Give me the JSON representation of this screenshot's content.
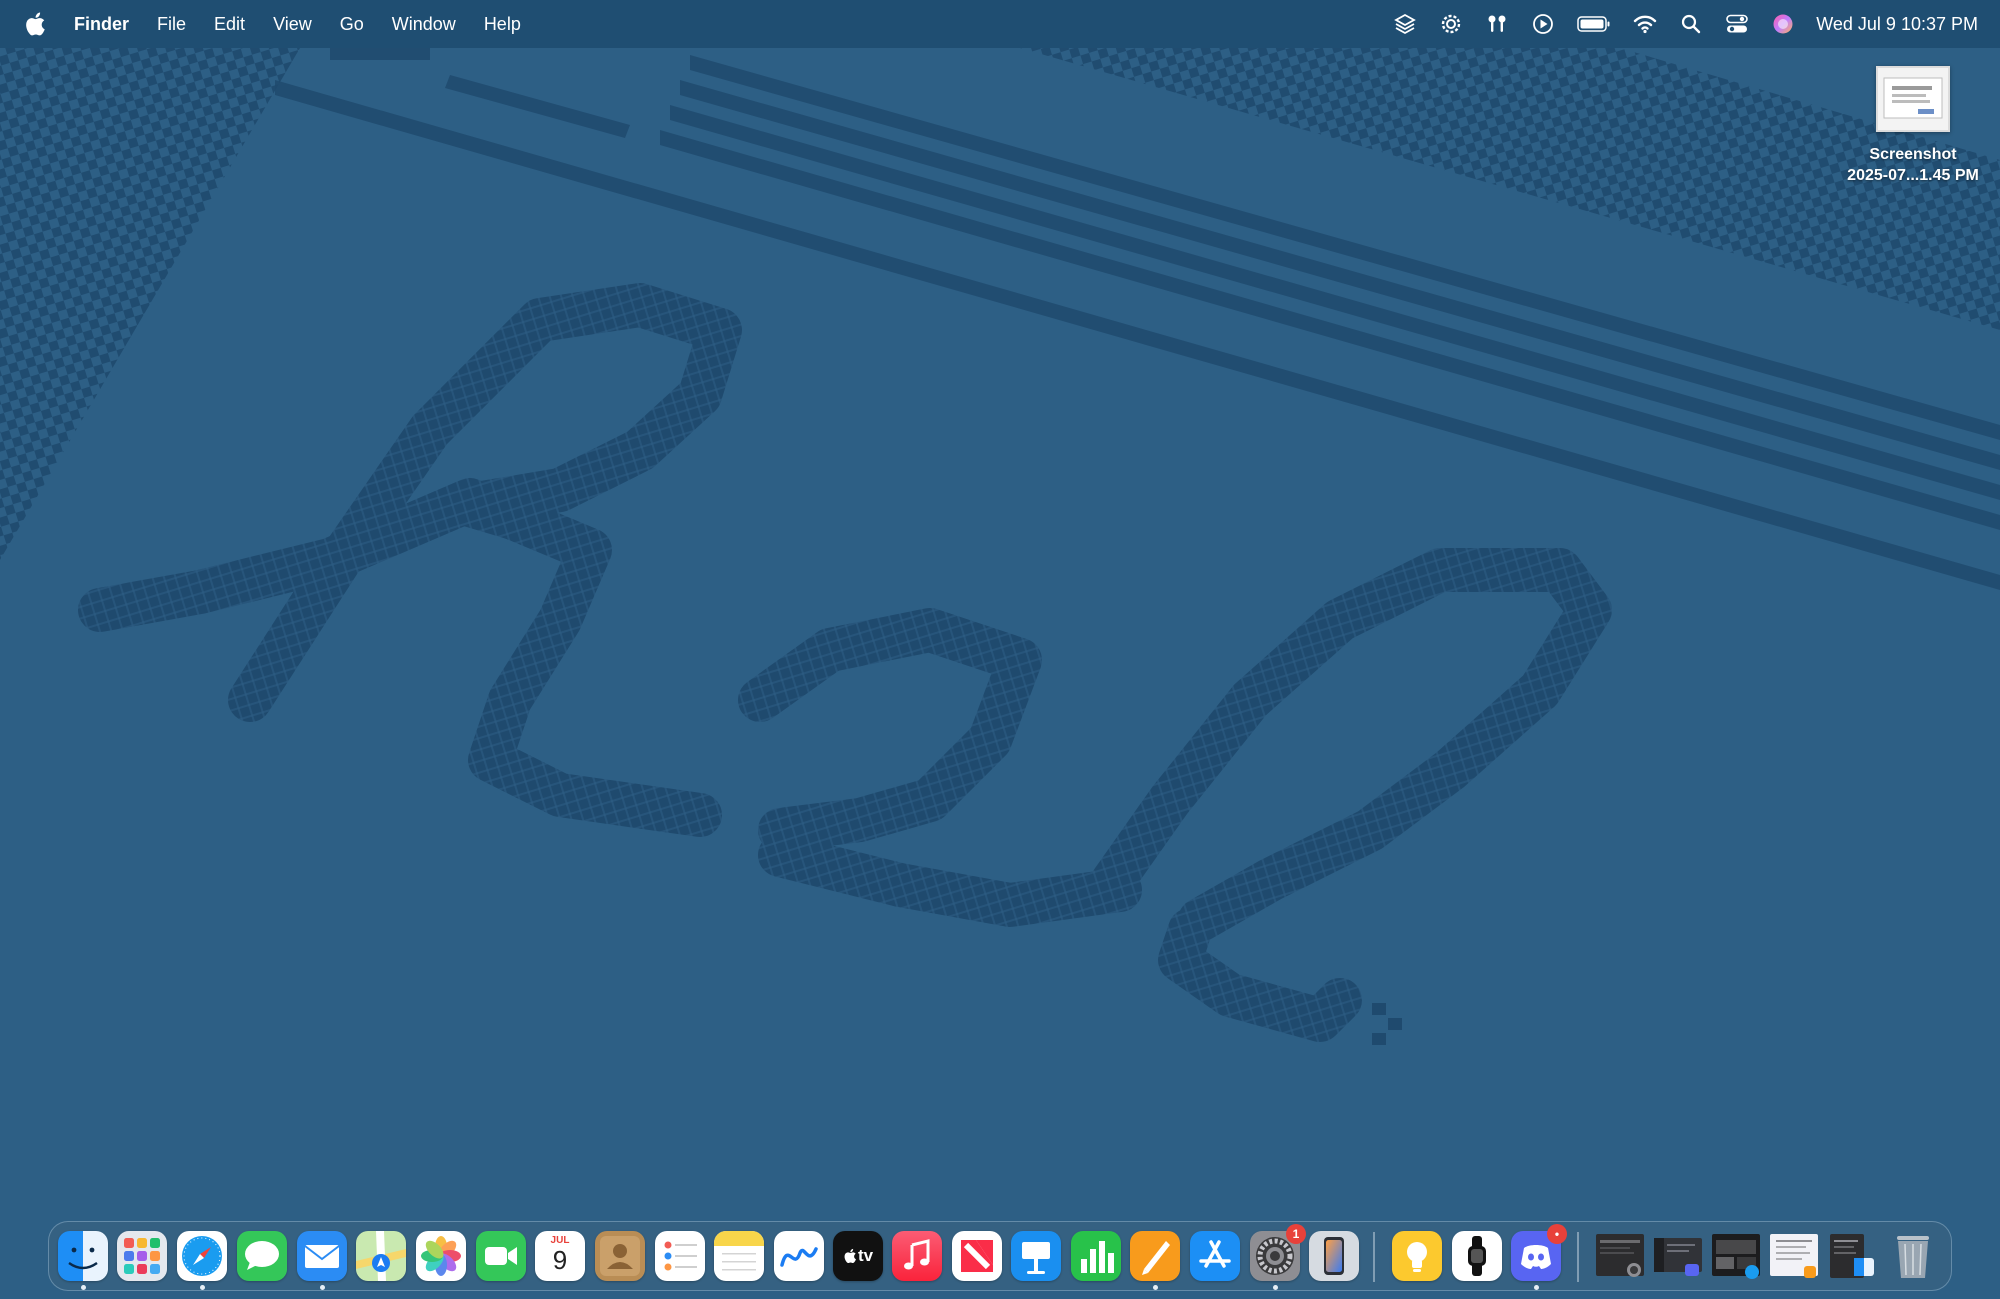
{
  "menubar": {
    "app_name": "Finder",
    "menus": [
      "File",
      "Edit",
      "View",
      "Go",
      "Window",
      "Help"
    ],
    "clock": "Wed Jul 9  10:37 PM",
    "status_icons": [
      "layers-icon",
      "gear-badge-icon",
      "airpods-icon",
      "play-icon",
      "battery-icon",
      "wifi-icon",
      "search-icon",
      "control-center-icon",
      "siri-icon"
    ]
  },
  "desktop": {
    "file": {
      "name_line1": "Screenshot",
      "name_line2": "2025-07...1.45 PM"
    },
    "wallpaper_colors": {
      "base": "#2d5f85",
      "pattern": "#1f4a6e"
    }
  },
  "dock": {
    "calendar": {
      "month": "JUL",
      "day": "9"
    },
    "tv_label": "tv",
    "badges": {
      "system_settings": "1",
      "discord": "•"
    },
    "apps": [
      "finder",
      "launchpad",
      "safari",
      "messages",
      "mail",
      "maps",
      "photos",
      "facetime",
      "calendar",
      "contacts",
      "reminders",
      "notes",
      "freeform",
      "apple-tv",
      "music",
      "news",
      "keynote",
      "numbers",
      "pages",
      "app-store",
      "system-settings",
      "iphone-mirroring",
      "tips",
      "watch-app",
      "discord"
    ],
    "window_previews": [
      "activity-window",
      "discord-window",
      "safari-window",
      "pages-window",
      "finder-window"
    ]
  }
}
